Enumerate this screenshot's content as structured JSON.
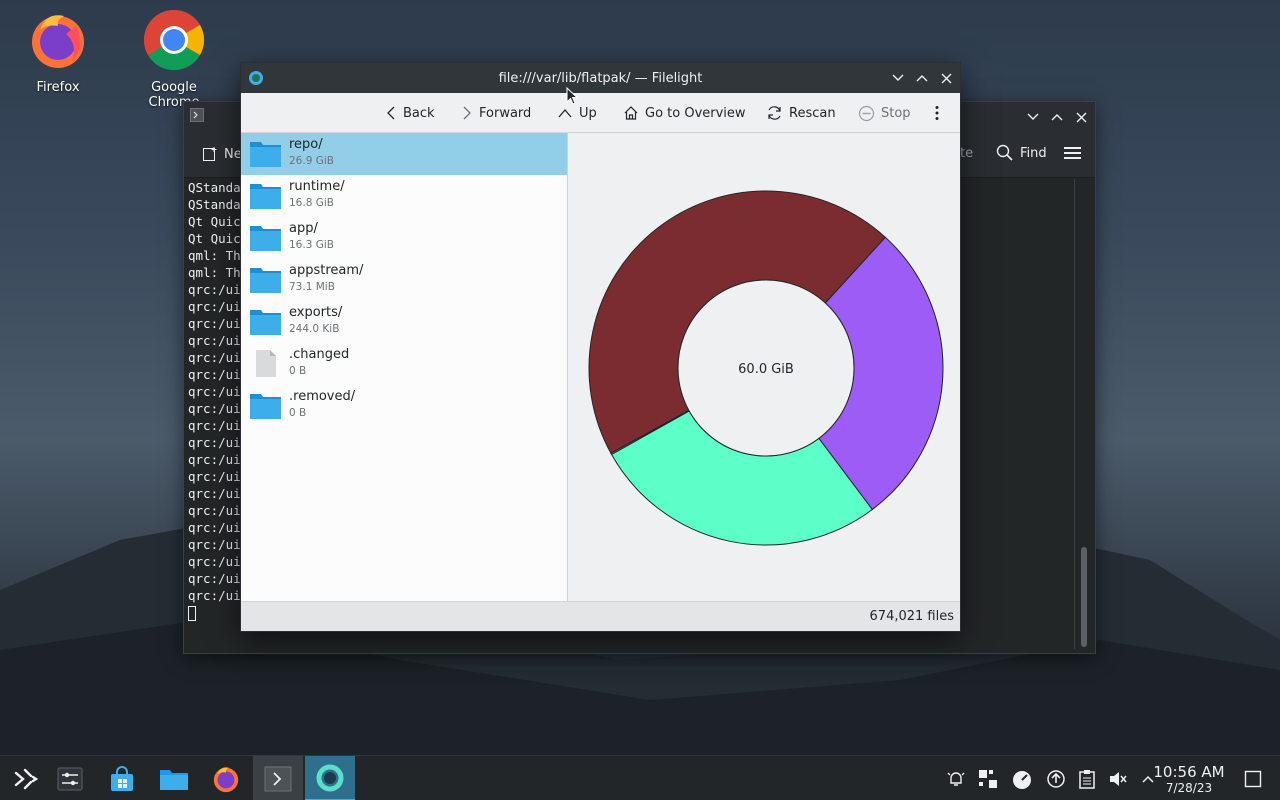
{
  "desktop": {
    "icons": [
      {
        "label": "Firefox"
      },
      {
        "label": "Google Chrome"
      }
    ]
  },
  "terminal": {
    "toolbar": {
      "new_tab_label": "Ne",
      "paste_label": "te",
      "find_label": "Find"
    },
    "lines": [
      "QStanda",
      "QStanda",
      "Qt Quic",
      "Qt Quic",
      "qml: Th",
      "qml: Th",
      "qrc:/ui",
      "qrc:/ui",
      "qrc:/ui",
      "qrc:/ui",
      "qrc:/ui",
      "qrc:/ui",
      "qrc:/ui",
      "qrc:/ui",
      "qrc:/ui",
      "qrc:/ui",
      "qrc:/ui",
      "qrc:/ui",
      "qrc:/ui",
      "qrc:/ui",
      "qrc:/ui",
      "qrc:/ui",
      "qrc:/ui",
      "qrc:/ui",
      "qrc:/ui"
    ]
  },
  "filelight": {
    "title": "file:///var/lib/flatpak/ — Filelight",
    "toolbar": {
      "back": "Back",
      "forward": "Forward",
      "up": "Up",
      "overview": "Go to Overview",
      "rescan": "Rescan",
      "stop": "Stop"
    },
    "entries": [
      {
        "name": "repo/",
        "size": "26.9 GiB",
        "kind": "folder",
        "selected": true
      },
      {
        "name": "runtime/",
        "size": "16.8 GiB",
        "kind": "folder",
        "selected": false
      },
      {
        "name": "app/",
        "size": "16.3 GiB",
        "kind": "folder",
        "selected": false
      },
      {
        "name": "appstream/",
        "size": "73.1 MiB",
        "kind": "folder",
        "selected": false
      },
      {
        "name": "exports/",
        "size": "244.0 KiB",
        "kind": "folder",
        "selected": false
      },
      {
        "name": ".changed",
        "size": "0 B",
        "kind": "file",
        "selected": false
      },
      {
        "name": ".removed/",
        "size": "0 B",
        "kind": "folder",
        "selected": false
      }
    ],
    "center_label": "60.0 GiB",
    "status": "674,021 files",
    "colors": {
      "repo": "#7b2c30",
      "runtime": "#9d5cf5",
      "app": "#5cffc8",
      "selection": "#93cee9",
      "folder": "#3daee9"
    }
  },
  "chart_data": {
    "type": "pie",
    "center_label": "60.0 GiB",
    "categories": [
      "repo/",
      "runtime/",
      "app/",
      "appstream/",
      "exports/",
      ".changed",
      ".removed/"
    ],
    "values": [
      26.9,
      16.8,
      16.3,
      0.0714,
      0.000233,
      0,
      0
    ],
    "unit": "GiB"
  },
  "taskbar": {
    "time": "10:56 AM",
    "date": "7/28/23"
  }
}
